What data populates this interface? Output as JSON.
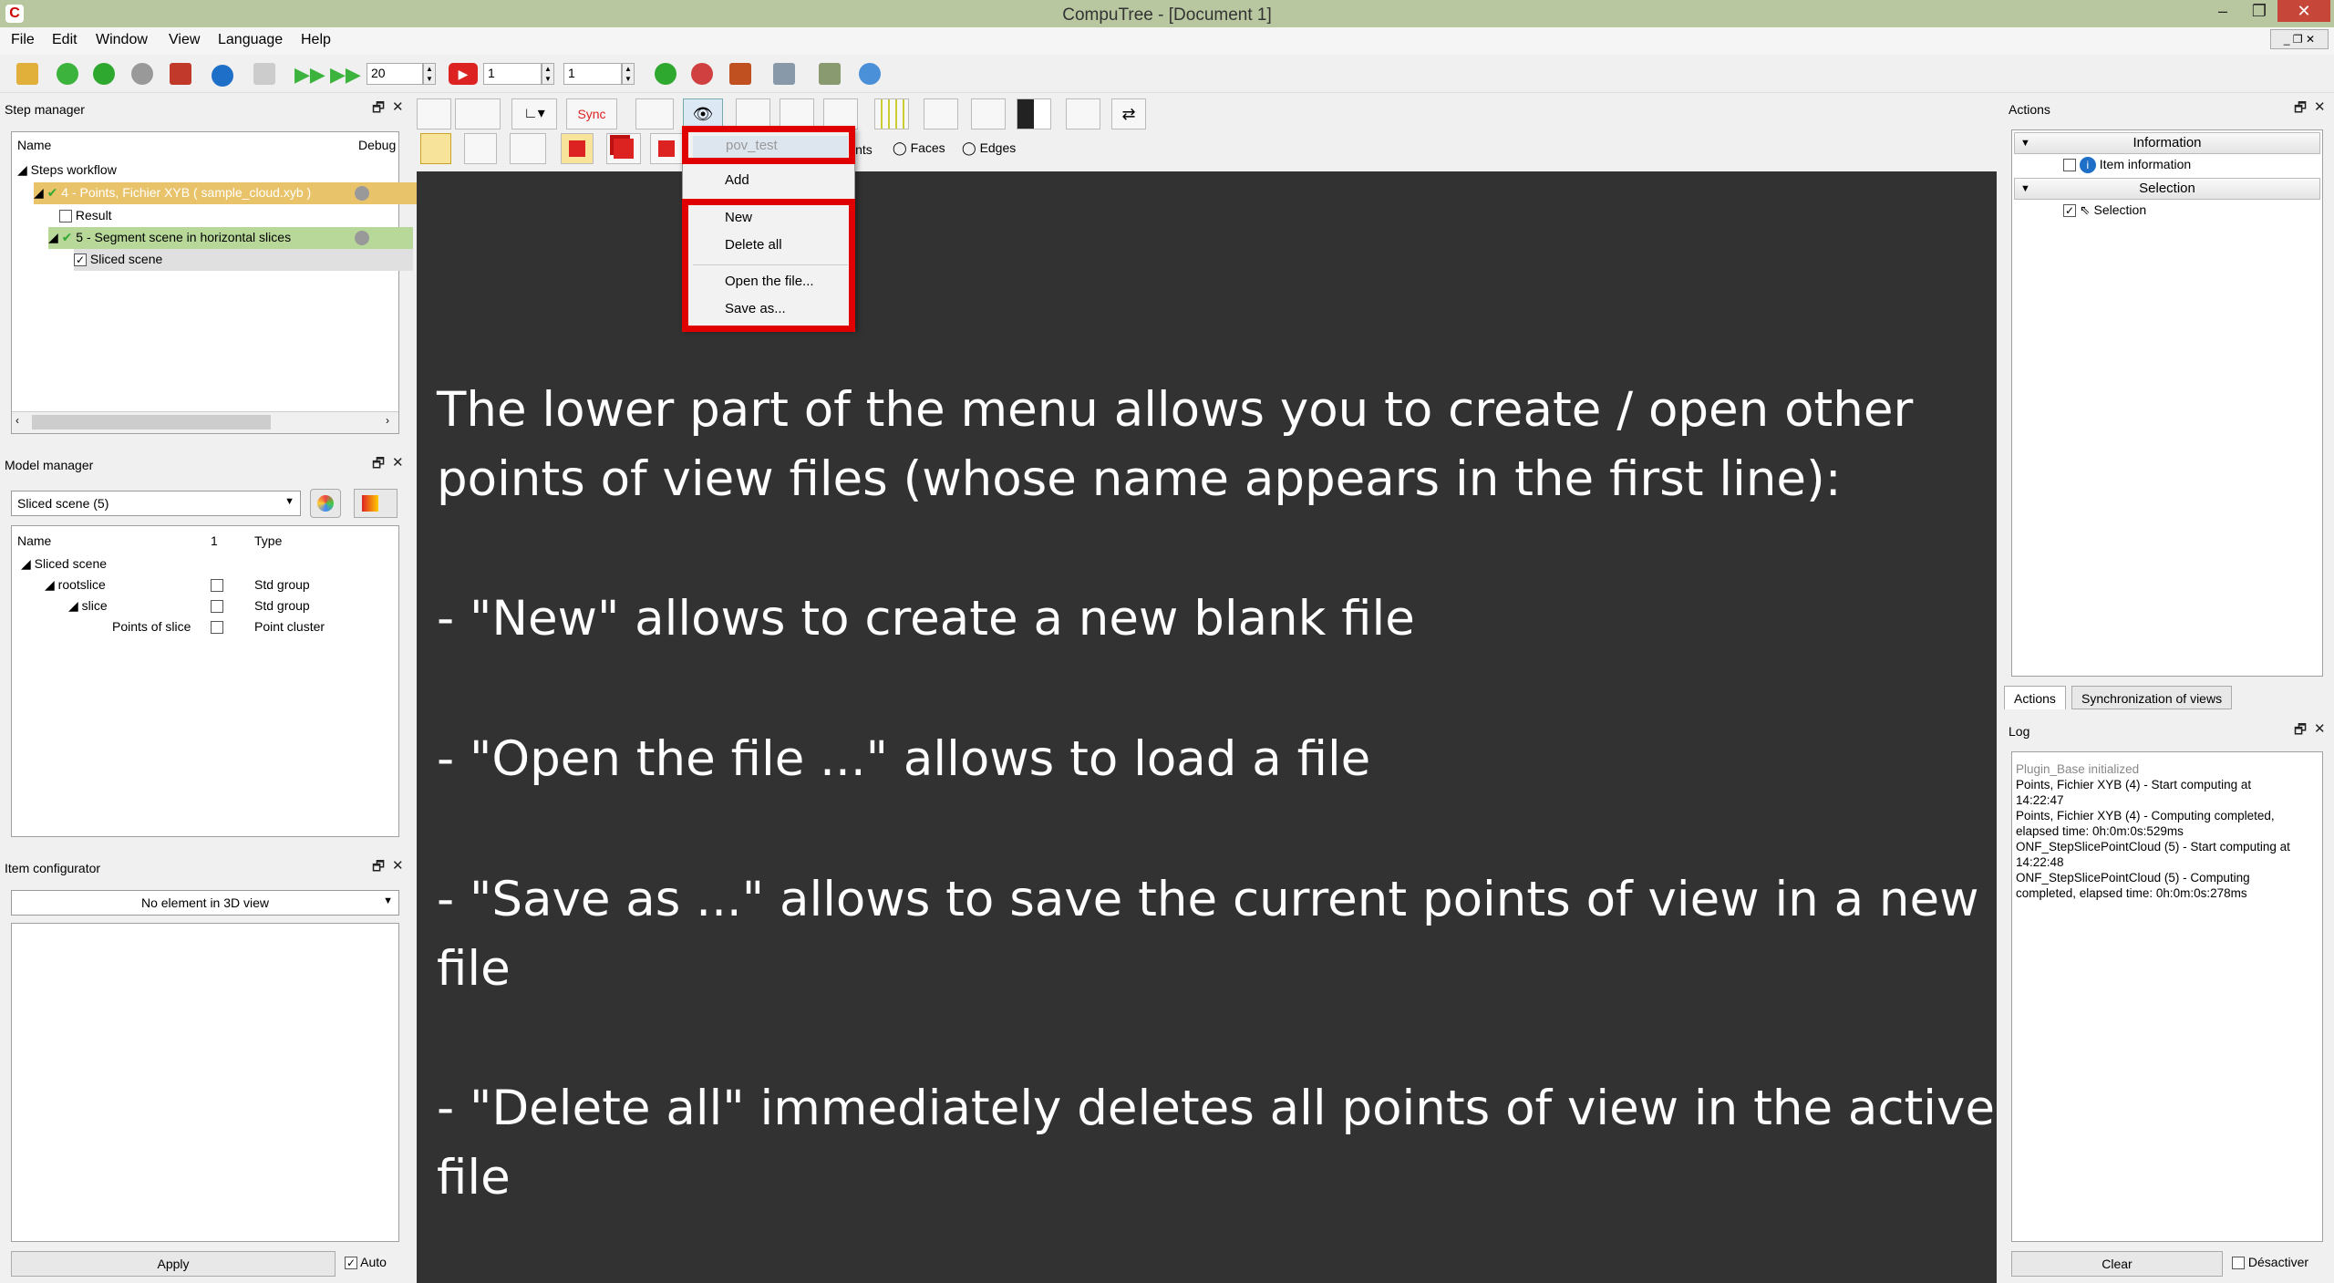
{
  "window": {
    "title": "CompuTree - [Document 1]",
    "app_icon": "C"
  },
  "menubar": [
    "File",
    "Edit",
    "Window",
    "View",
    "Language",
    "Help"
  ],
  "toolbar": {
    "spin_delay": "20",
    "spin_step_a": "1",
    "spin_step_b": "1"
  },
  "step_manager": {
    "title": "Step manager",
    "col_name": "Name",
    "col_debug": "Debug",
    "rows": [
      {
        "label": "Steps workflow"
      },
      {
        "label": "4 - Points, Fichier XYB ( sample_cloud.xyb )"
      },
      {
        "label": "Result"
      },
      {
        "label": "5 - Segment scene in horizontal slices"
      },
      {
        "label": "Sliced scene"
      }
    ]
  },
  "model_manager": {
    "title": "Model manager",
    "combo_value": "Sliced scene (5)",
    "col_name": "Name",
    "col_1": "1",
    "col_type": "Type",
    "rows": [
      {
        "name": "Sliced scene",
        "type": ""
      },
      {
        "name": "rootslice",
        "type": "Std group"
      },
      {
        "name": "slice",
        "type": "Std group"
      },
      {
        "name": "Points of slice",
        "type": "Point cluster"
      }
    ]
  },
  "item_configurator": {
    "title": "Item configurator",
    "combo_value": "No element in 3D view",
    "apply_label": "Apply",
    "auto_label": "Auto"
  },
  "view_toolbar": {
    "sync_label": "Sync",
    "points_label": "ints",
    "faces_label": "Faces",
    "edges_label": "Edges"
  },
  "pov_menu": {
    "current": "pov_test",
    "add": "Add",
    "new": "New",
    "delete_all": "Delete all",
    "open_file": "Open the file...",
    "save_as": "Save as..."
  },
  "overlay": {
    "line1": "The lower part of the menu allows you to create / open other",
    "line2": "points of view files (whose name appears in the first line):",
    "line3": "- \"New\" allows to create a new blank file",
    "line4": "- \"Open the file ...\" allows to load a file",
    "line5": "- \"Save as ...\" allows to save the current points of view in a new",
    "line6": "file",
    "line7": "- \"Delete all\" immediately deletes all points of view in the active",
    "line8": "file"
  },
  "actions_panel": {
    "title": "Actions",
    "section_info": "Information",
    "item_info": "Item information",
    "section_selection": "Selection",
    "item_selection": "Selection",
    "tab_actions": "Actions",
    "tab_sync": "Synchronization of views"
  },
  "log_panel": {
    "title": "Log",
    "lines": [
      "Plugin_Base initialized",
      "Points, Fichier XYB (4) - Start computing at",
      "14:22:47",
      "Points, Fichier XYB (4) - Computing completed,",
      "elapsed time: 0h:0m:0s:529ms",
      "ONF_StepSlicePointCloud (5) - Start computing at",
      "14:22:48",
      "ONF_StepSlicePointCloud (5) - Computing",
      "completed, elapsed time: 0h:0m:0s:278ms"
    ],
    "clear_label": "Clear",
    "disable_label": "Désactiver"
  },
  "colors": {
    "titlebar": "#b9c7a0",
    "view_bg": "#323232",
    "highlight_red": "#e00000",
    "step_row_orange": "#e8c36a",
    "step_row_green": "#b8d89a"
  }
}
